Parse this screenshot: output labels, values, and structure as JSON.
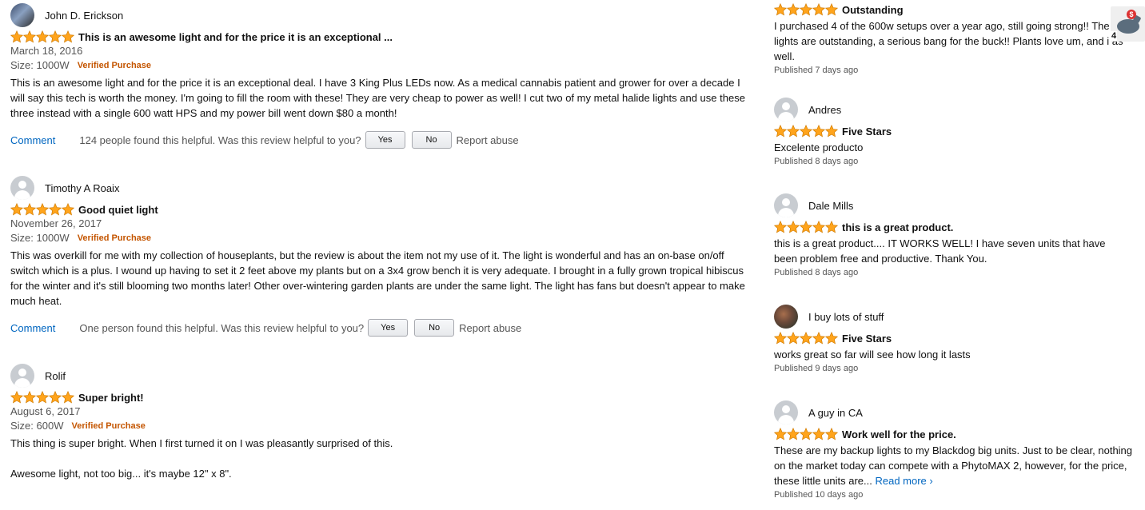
{
  "colors": {
    "star": "#ffa41c",
    "verified": "#c45500",
    "link": "#0066c0"
  },
  "left_reviews": [
    {
      "name": "John D. Erickson",
      "title": "This is an awesome light and for the price it is an exceptional ...",
      "date": "March 18, 2016",
      "size": "Size: 1000W",
      "verified": "Verified Purchase",
      "text": "This is an awesome light and for the price it is an exceptional deal. I have 3 King Plus LEDs now. As a medical cannabis patient and grower for over a decade I will say this tech is worth the money. I'm going to fill the room with these! They are very cheap to power as well! I cut two of my metal halide lights and use these three instead with a single 600 watt HPS and my power bill went down $80 a month!",
      "comment": "Comment",
      "helpful": "124 people found this helpful. Was this review helpful to you?",
      "yes": "Yes",
      "no": "No",
      "abuse": "Report abuse",
      "rating": 5
    },
    {
      "name": "Timothy A Roaix",
      "title": "Good quiet light",
      "date": "November 26, 2017",
      "size": "Size: 1000W",
      "verified": "Verified Purchase",
      "text": "This was overkill for me with my collection of houseplants, but the review is about the item not my use of it. The light is wonderful and has an on-base on/off switch which is a plus. I wound up having to set it 2 feet above my plants but on a 3x4 grow bench it is very adequate. I brought in a fully grown tropical hibiscus for the winter and it's still blooming two months later! Other over-wintering garden plants are under the same light. The light has fans but doesn't appear to make much heat.",
      "comment": "Comment",
      "helpful": "One person found this helpful. Was this review helpful to you?",
      "yes": "Yes",
      "no": "No",
      "abuse": "Report abuse",
      "rating": 5
    },
    {
      "name": "Rolif",
      "title": "Super bright!",
      "date": "August 6, 2017",
      "size": "Size: 600W",
      "verified": "Verified Purchase",
      "text1": "This thing is super bright. When I first turned it on I was pleasantly surprised of this.",
      "text2": "Awesome light, not too big... it's maybe 12\" x 8\".",
      "rating": 5
    }
  ],
  "right_reviews": [
    {
      "title": "Outstanding",
      "text": "I purchased 4 of the 600w setups over a year ago, still going strong!! The lights are outstanding, a serious bang for the buck!! Plants love um, and i as well.",
      "published": "Published 7 days ago",
      "rating": 5
    },
    {
      "name": "Andres",
      "title": "Five Stars",
      "text": "Excelente producto",
      "published": "Published 8 days ago",
      "rating": 5
    },
    {
      "name": "Dale Mills",
      "title": "this is a great product.",
      "text": "this is a great product.... IT WORKS WELL! I have seven units that have been problem free and productive. Thank You.",
      "published": "Published 8 days ago",
      "rating": 5
    },
    {
      "name": "I buy lots of stuff",
      "title": "Five Stars",
      "text": "works great so far will see how long it lasts",
      "published": "Published 9 days ago",
      "rating": 5
    },
    {
      "name": "A guy in CA",
      "title": "Work well for the price.",
      "text": "These are my backup lights to my Blackdog big units. Just to be clear, nothing on the market today can compete with a PhytoMAX 2, however, for the price, these little units are...",
      "read_more": "Read more ›",
      "published": "Published 10 days ago",
      "rating": 5
    }
  ],
  "extension": {
    "icon": "piggy-bank-icon",
    "badge": "4",
    "coin": "$"
  }
}
